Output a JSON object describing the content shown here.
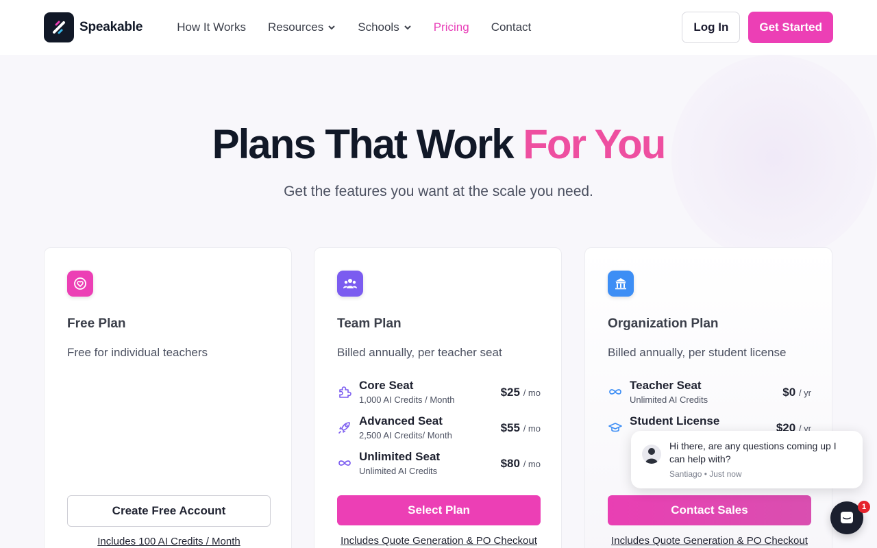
{
  "brand": {
    "name": "Speakable",
    "accent": "#ec3fb5"
  },
  "nav": {
    "items": [
      {
        "label": "How It Works"
      },
      {
        "label": "Resources"
      },
      {
        "label": "Schools"
      },
      {
        "label": "Pricing"
      },
      {
        "label": "Contact"
      }
    ],
    "login_label": "Log In",
    "get_started_label": "Get Started"
  },
  "hero": {
    "title_main": "Plans That Work ",
    "title_accent": "For You",
    "subtitle": "Get the features you want at the scale you need."
  },
  "plans": [
    {
      "name": "Free Plan",
      "icon": "heart-icon",
      "description": "Free for individual teachers",
      "cta": "Create Free Account",
      "note": "Includes 100 AI Credits / Month"
    },
    {
      "name": "Team Plan",
      "icon": "users-icon",
      "description": "Billed annually, per teacher seat",
      "seats": [
        {
          "name": "Core Seat",
          "credits": "1,000 AI Credits / Month",
          "price": "$25",
          "period": "/ mo",
          "icon": "puzzle-icon"
        },
        {
          "name": "Advanced Seat",
          "credits": "2,500 AI Credits/ Month",
          "price": "$55",
          "period": "/ mo",
          "icon": "rocket-icon"
        },
        {
          "name": "Unlimited Seat",
          "credits": "Unlimited AI Credits",
          "price": "$80",
          "period": "/ mo",
          "icon": "infinity-icon"
        }
      ],
      "cta": "Select Plan",
      "note": "Includes Quote Generation & PO Checkout"
    },
    {
      "name": "Organization Plan",
      "icon": "bank-icon",
      "description": "Billed annually, per student license",
      "seats": [
        {
          "name": "Teacher Seat",
          "credits": "Unlimited AI Credits",
          "price": "$0",
          "period": "/ yr",
          "icon": "infinity-icon"
        },
        {
          "name": "Student License",
          "credits": "",
          "price": "$20",
          "period": "/ yr",
          "icon": "graduation-cap-icon"
        }
      ],
      "cta": "Contact Sales",
      "note": "Includes Quote Generation & PO Checkout"
    }
  ],
  "chat": {
    "message": "Hi there, are any questions coming up I can help with?",
    "meta": "Santiago • Just now",
    "badge": "1"
  }
}
